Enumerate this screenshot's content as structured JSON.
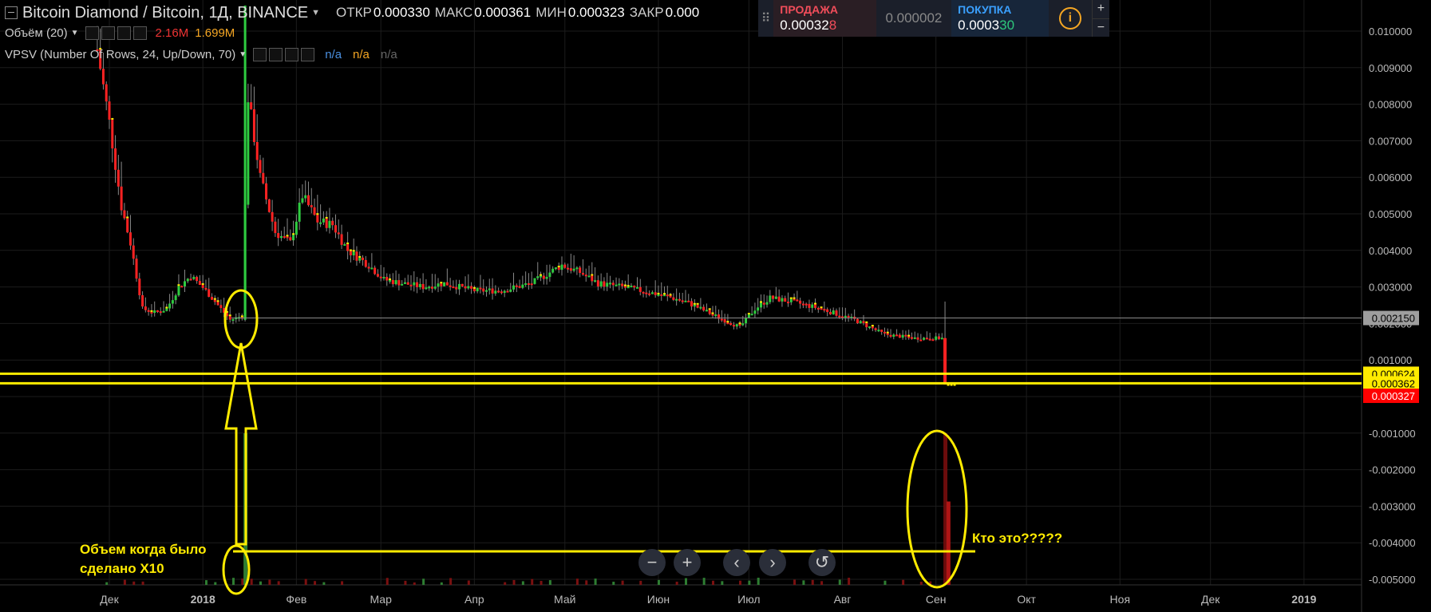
{
  "header": {
    "symbol": "Bitcoin Diamond / Bitcoin, 1Д, BINANCE",
    "open_label": "ОТКР",
    "open_value": "0.000330",
    "high_label": "МАКС",
    "high_value": "0.000361",
    "low_label": "МИН",
    "low_value": "0.000323",
    "close_label": "ЗАКР",
    "close_value": "0.000"
  },
  "indicators": {
    "volume_label": "Объём (20)",
    "volume_value_1": "2.16M",
    "volume_value_2": "1.699M",
    "vpsv_label": "VPSV (Number Of Rows, 24, Up/Down, 70)",
    "vpsv_values": [
      "n/a",
      "n/a",
      "n/a"
    ]
  },
  "trade_panel": {
    "sell_label": "ПРОДАЖА",
    "sell_price_main": "0.00032",
    "sell_price_tail": "8",
    "spread": "0.000002",
    "buy_label": "ПОКУПКА",
    "buy_price_main": "0.0003",
    "buy_price_tail": "30",
    "info_icon": "i",
    "zoom_in": "+",
    "zoom_out": "−"
  },
  "annotations": {
    "left_text_line1": "Объем когда было",
    "left_text_line2": "сделано Х10",
    "right_text": "Кто это?????"
  },
  "colors": {
    "background": "#000000",
    "up_candle": "#2ecc40",
    "down_candle": "#ff2222",
    "annotation": "#ffeb00",
    "last_price": "#ff0000"
  },
  "chart_data": {
    "type": "candlestick",
    "title": "Bitcoin Diamond / Bitcoin, 1Д, BINANCE",
    "ylim": [
      -0.0052,
      0.0107
    ],
    "y_ticks": [
      "0.010000",
      "0.009000",
      "0.008000",
      "0.007000",
      "0.006000",
      "0.005000",
      "0.004000",
      "0.003000",
      "0.002000",
      "0.001000",
      "0.000000",
      "-0.001000",
      "-0.002000",
      "-0.003000",
      "-0.004000",
      "-0.005000"
    ],
    "x_tick_labels": [
      "Дек",
      "2018",
      "Фев",
      "Мар",
      "Апр",
      "Май",
      "Июн",
      "Июл",
      "Авг",
      "Сен",
      "Окт",
      "Ноя",
      "Дек",
      "2019"
    ],
    "price_series_points": [
      [
        "2017-11-27",
        0.0095
      ],
      [
        "2017-12-01",
        0.0075
      ],
      [
        "2017-12-05",
        0.0052
      ],
      [
        "2017-12-08",
        0.0042
      ],
      [
        "2017-12-12",
        0.0024
      ],
      [
        "2017-12-16",
        0.0023
      ],
      [
        "2017-12-20",
        0.0024
      ],
      [
        "2017-12-24",
        0.003
      ],
      [
        "2017-12-28",
        0.0033
      ],
      [
        "2018-01-02",
        0.0029
      ],
      [
        "2018-01-06",
        0.0025
      ],
      [
        "2018-01-10",
        0.0021
      ],
      [
        "2018-01-14",
        0.0022
      ],
      [
        "2018-01-16",
        0.0082
      ],
      [
        "2018-01-20",
        0.006
      ],
      [
        "2018-01-25",
        0.0045
      ],
      [
        "2018-01-30",
        0.0042
      ],
      [
        "2018-02-03",
        0.0055
      ],
      [
        "2018-02-08",
        0.0048
      ],
      [
        "2018-02-13",
        0.0047
      ],
      [
        "2018-02-18",
        0.004
      ],
      [
        "2018-02-25",
        0.0036
      ],
      [
        "2018-03-02",
        0.0032
      ],
      [
        "2018-03-08",
        0.0031
      ],
      [
        "2018-03-15",
        0.003
      ],
      [
        "2018-03-22",
        0.0031
      ],
      [
        "2018-04-01",
        0.0029
      ],
      [
        "2018-04-10",
        0.0029
      ],
      [
        "2018-04-20",
        0.0031
      ],
      [
        "2018-04-30",
        0.0036
      ],
      [
        "2018-05-06",
        0.0034
      ],
      [
        "2018-05-12",
        0.0031
      ],
      [
        "2018-05-20",
        0.003
      ],
      [
        "2018-06-01",
        0.0028
      ],
      [
        "2018-06-10",
        0.0026
      ],
      [
        "2018-06-20",
        0.0022
      ],
      [
        "2018-06-28",
        0.0019
      ],
      [
        "2018-07-03",
        0.0024
      ],
      [
        "2018-07-08",
        0.0027
      ],
      [
        "2018-07-15",
        0.0026
      ],
      [
        "2018-07-25",
        0.0024
      ],
      [
        "2018-08-05",
        0.0021
      ],
      [
        "2018-08-15",
        0.0017
      ],
      [
        "2018-08-25",
        0.0016
      ],
      [
        "2018-09-03",
        0.0016
      ],
      [
        "2018-09-04",
        0.00033
      ]
    ],
    "price_labels": [
      {
        "value": 0.00215,
        "label": "0.002150",
        "style": "gray"
      },
      {
        "value": 0.000624,
        "label": "0.000624",
        "style": "yellow"
      },
      {
        "value": 0.000362,
        "label": "0.000362",
        "style": "yellow"
      },
      {
        "value": 0.000327,
        "label": "0.000327",
        "style": "red"
      }
    ],
    "horizontal_lines": [
      0.00215,
      0.000624,
      0.000362
    ],
    "volume_bars": [
      {
        "x": "2018-01-15",
        "value": 1.0,
        "color": "green"
      },
      {
        "x": "2018-09-04",
        "value": 1.0,
        "color": "darkred"
      },
      {
        "x": "2018-09-05",
        "value": 0.55,
        "color": "red"
      }
    ]
  }
}
